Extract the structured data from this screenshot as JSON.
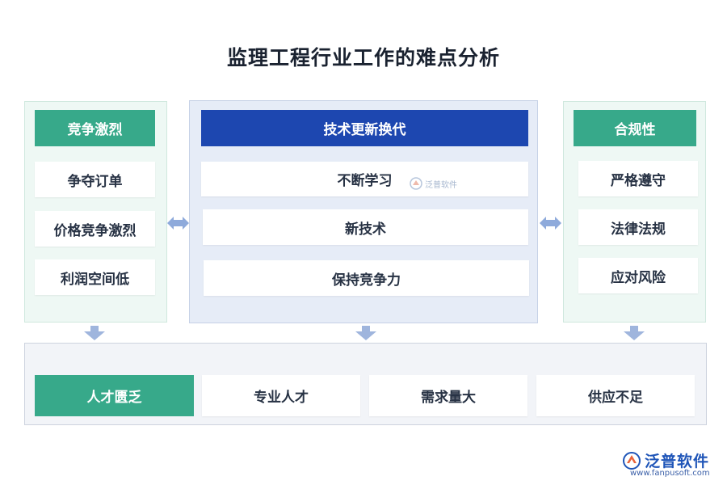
{
  "title": "监理工程行业工作的难点分析",
  "left": {
    "header": "竞争激烈",
    "items": [
      "争夺订单",
      "价格竞争激烈",
      "利润空间低"
    ]
  },
  "middle": {
    "header": "技术更新换代",
    "items": [
      "不断学习",
      "新技术",
      "保持竞争力"
    ]
  },
  "right": {
    "header": "合规性",
    "items": [
      "严格遵守",
      "法律法规",
      "应对风险"
    ]
  },
  "bottom": {
    "header": "人才匮乏",
    "items": [
      "专业人才",
      "需求量大",
      "供应不足"
    ]
  },
  "watermark": {
    "brand": "泛普软件"
  },
  "logo": {
    "brand": "泛普软件",
    "url": "www.fanpusoft.com"
  },
  "colors": {
    "green": "#37a98a",
    "blue": "#1d47b0",
    "arrow": "#8eaadb"
  }
}
